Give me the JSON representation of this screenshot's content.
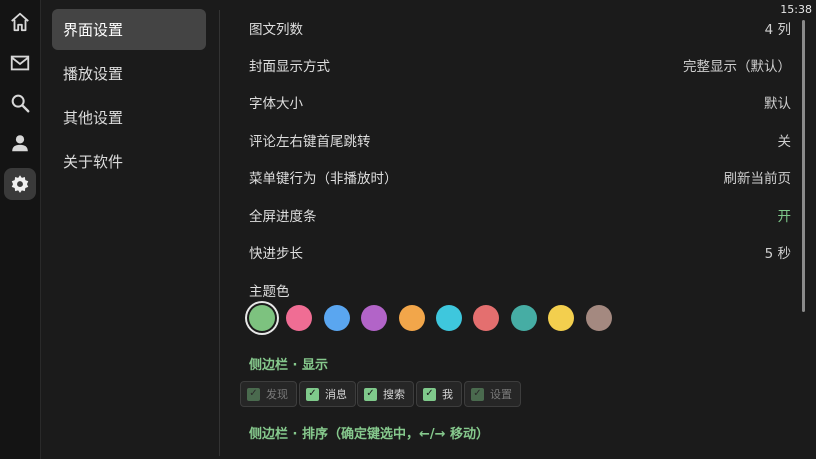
{
  "status": {
    "time": "15:38"
  },
  "rail": {
    "items": [
      {
        "icon": "home-icon",
        "active": false
      },
      {
        "icon": "mail-icon",
        "active": false
      },
      {
        "icon": "search-icon",
        "active": false
      },
      {
        "icon": "user-icon",
        "active": false
      },
      {
        "icon": "gear-icon",
        "active": true
      }
    ]
  },
  "menu": {
    "items": [
      {
        "label": "界面设置",
        "active": true
      },
      {
        "label": "播放设置",
        "active": false
      },
      {
        "label": "其他设置",
        "active": false
      },
      {
        "label": "关于软件",
        "active": false
      }
    ]
  },
  "settings": [
    {
      "label": "图文列数",
      "value": "4 列"
    },
    {
      "label": "封面显示方式",
      "value": "完整显示（默认）"
    },
    {
      "label": "字体大小",
      "value": "默认"
    },
    {
      "label": "评论左右键首尾跳转",
      "value": "关"
    },
    {
      "label": "菜单键行为（非播放时）",
      "value": "刷新当前页"
    },
    {
      "label": "全屏进度条",
      "value": "开",
      "value_color": "#7fc98b"
    },
    {
      "label": "快进步长",
      "value": "5 秒"
    }
  ],
  "theme": {
    "label": "主题色",
    "selected_index": 0,
    "colors": [
      "#7dc27f",
      "#f06d94",
      "#5aa6f0",
      "#b264c8",
      "#f2a64a",
      "#3ec7dd",
      "#e46f6f",
      "#46ada4",
      "#f3cf4e",
      "#a48980"
    ]
  },
  "sidebar_display": {
    "title": "侧边栏 · 显示",
    "chips": [
      {
        "label": "发现",
        "checked": true,
        "enabled": false
      },
      {
        "label": "消息",
        "checked": true,
        "enabled": true
      },
      {
        "label": "搜索",
        "checked": true,
        "enabled": true
      },
      {
        "label": "我",
        "checked": true,
        "enabled": true
      },
      {
        "label": "设置",
        "checked": true,
        "enabled": false
      }
    ]
  },
  "sidebar_order": {
    "title": "侧边栏 · 排序（确定键选中，←/→ 移动）"
  },
  "colors": {
    "accent": "#7fc98b",
    "background": "#1b1b1b",
    "panel_active": "#444444"
  }
}
